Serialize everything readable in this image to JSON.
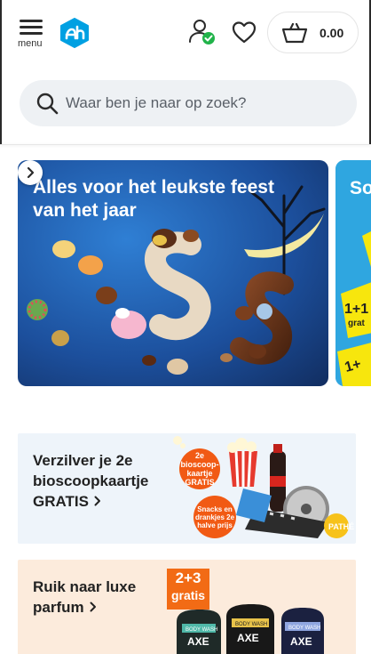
{
  "header": {
    "menu_label": "menu",
    "cart_total": "0.00",
    "colors": {
      "brand": "#00a0e2",
      "status_ok": "#21b34a"
    }
  },
  "search": {
    "placeholder": "Waar ben je naar op zoek?"
  },
  "carousel": {
    "slides": [
      {
        "title": "Alles voor het leukste feest van het jaar"
      },
      {
        "title": "So"
      }
    ]
  },
  "promos": [
    {
      "title": "Verzilver je 2e bioscoopkaartje GRATIS",
      "badge_top": "2e bioscoop-kaartje GRATIS",
      "badge_bottom": "Snacks en drankjes 2e halve prijs",
      "logo_text": "PATHÉ"
    },
    {
      "title": "Ruik naar luxe parfum",
      "deal_line1": "2+3",
      "deal_line2": "gratis",
      "product_text": "BODY WASH",
      "brand_text": "AXE"
    }
  ],
  "icons": [
    "menu-icon",
    "ah-logo",
    "account-icon",
    "heart-icon",
    "cart-icon",
    "search-icon",
    "chevron-right-icon"
  ]
}
